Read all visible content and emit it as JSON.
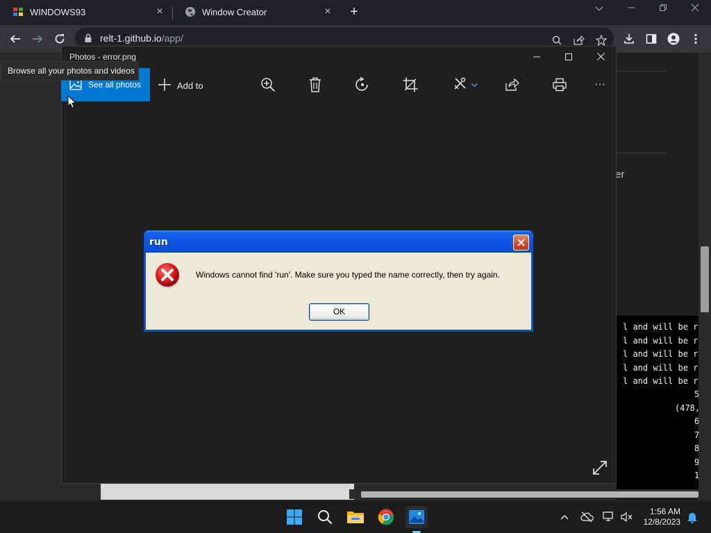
{
  "browser": {
    "tabs": [
      {
        "title": "WINDOWS93",
        "favicon": "windows93-icon",
        "close": "×"
      },
      {
        "title": "Window Creator",
        "favicon": "globe-icon",
        "close": "×"
      }
    ],
    "new_tab": "+",
    "url_host": "relt-1.github.io",
    "url_path": "/app/"
  },
  "background_page": {
    "fragment": "er",
    "console_lines": [
      "l and will be remo",
      "l and will be remo",
      "l and will be remo",
      "l and will be remo",
      "l and will be remo",
      "5",
      "(478,",
      "6",
      "7",
      "8",
      "9",
      "1"
    ]
  },
  "photos": {
    "title": "Photos - error.png",
    "see_all_label": "See all photos",
    "add_to_label": "Add to",
    "tooltip": "Browse all your photos and videos",
    "more": "···"
  },
  "dialog": {
    "title": "run",
    "message": "Windows cannot find 'run'. Make sure you typed the name correctly, then try again.",
    "ok_label": "OK"
  },
  "taskbar": {
    "time": "1:56 AM",
    "date": "12/8/2023"
  },
  "colors": {
    "accent": "#0078d4",
    "xp_title": "#0a4ed8",
    "xp_body": "#ece9d8",
    "taskbar_active": "#60cdff"
  }
}
